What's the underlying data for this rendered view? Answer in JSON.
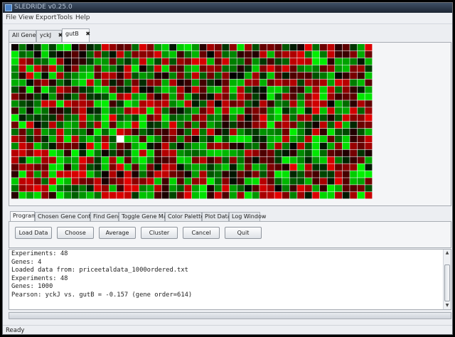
{
  "window": {
    "title": "SLEDRIDE v0.25.0"
  },
  "menu": [
    "File",
    "View",
    "Export",
    "Tools",
    "Help"
  ],
  "top_tabs": [
    {
      "label": "All Genes",
      "closable": false
    },
    {
      "label": "yckJ",
      "closable": true
    },
    {
      "label": "gutB",
      "closable": true,
      "active": true
    }
  ],
  "close_glyph": "✖",
  "heatmap": {
    "columns": 48,
    "rows": 22,
    "colors": {
      "negative": "#00ff00",
      "positive": "#ff0000",
      "neutral": "#000000",
      "selected": "#ffffff"
    },
    "selected_cell": {
      "row": 13,
      "col": 14
    }
  },
  "bottom_tabs": [
    "Program",
    "Chosen Gene Control",
    "Find Gene",
    "Toggle Gene Maps",
    "Color Palette",
    "Plot Data",
    "Log Window"
  ],
  "buttons": [
    "Load Data",
    "Choose",
    "Average",
    "Cluster",
    "Cancel",
    "Quit"
  ],
  "log": [
    "Experiments: 48",
    "Genes: 4",
    "Loaded data from: priceetaldata_1000ordered.txt",
    "Experiments: 48",
    "Genes: 1000",
    "Pearson: yckJ vs. gutB = -0.157 (gene order=614)"
  ],
  "status": "Ready"
}
